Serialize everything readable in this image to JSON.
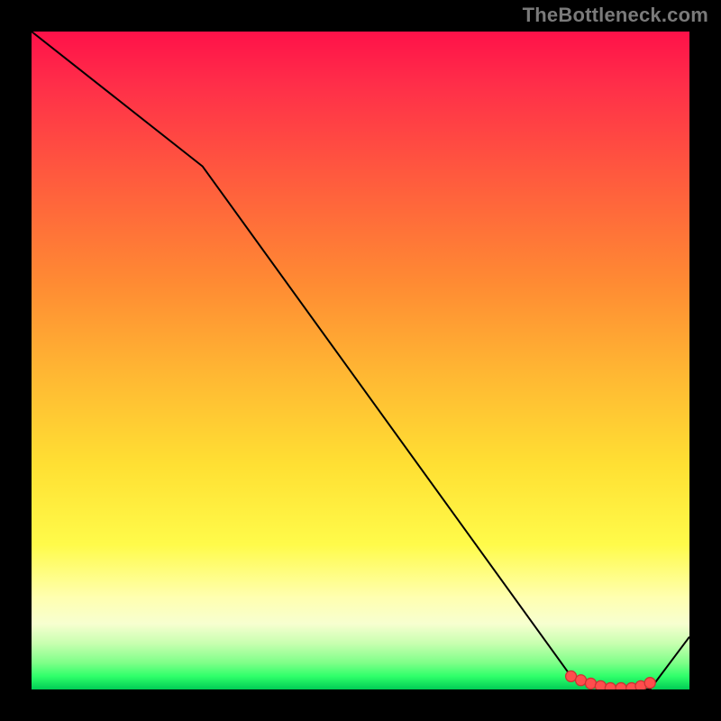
{
  "attribution": "TheBottleneck.com",
  "chart_data": {
    "type": "line",
    "title": "",
    "xlabel": "",
    "ylabel": "",
    "xlim": [
      0,
      100
    ],
    "ylim": [
      0,
      100
    ],
    "x": [
      0,
      26,
      82,
      88,
      94,
      100
    ],
    "y": [
      100,
      79.5,
      2,
      0,
      0,
      8
    ],
    "markers": {
      "x": [
        82,
        83.5,
        85,
        86.5,
        88,
        89.6,
        91.2,
        92.6,
        94
      ],
      "y": [
        2,
        1.4,
        0.9,
        0.5,
        0.2,
        0.2,
        0.2,
        0.5,
        1.0
      ]
    },
    "style": {
      "line_color": "#000000",
      "line_width": 2,
      "marker_color": "#ff4d4d",
      "marker_stroke": "#cc3333",
      "marker_radius": 6
    }
  }
}
